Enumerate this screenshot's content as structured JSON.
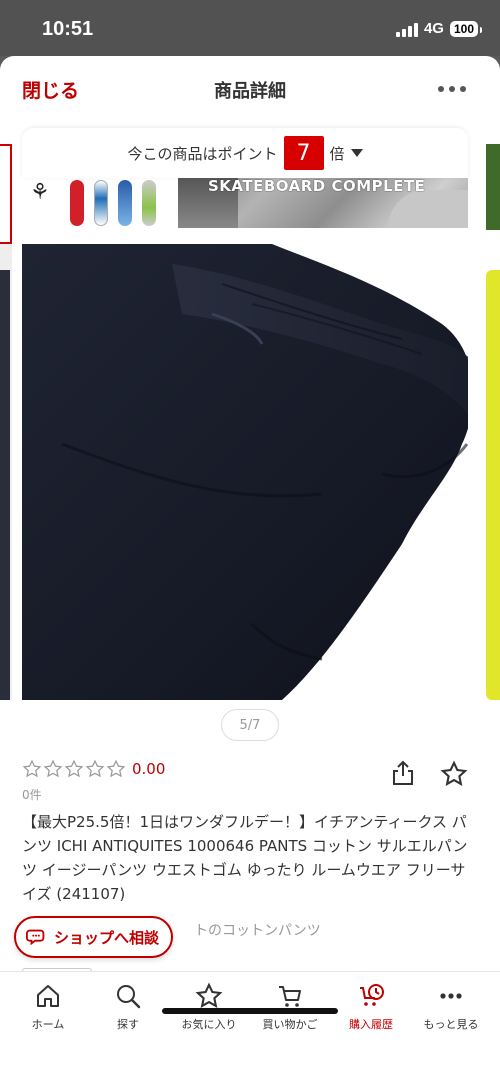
{
  "status_bar": {
    "time": "10:51",
    "network": "4G",
    "battery": "100"
  },
  "header": {
    "close_label": "閉じる",
    "title": "商品詳細",
    "more_icon": "more-dots-icon"
  },
  "point_banner": {
    "prefix": "今この商品はポイント",
    "multiplier": "7",
    "suffix": "倍"
  },
  "shop_banner": {
    "text": "SKATEBOARD COMPLETE"
  },
  "carousel": {
    "page_indicator": "5/7"
  },
  "rating": {
    "stars_filled": 0,
    "stars_total": 5,
    "value": "0.00",
    "review_count": "0件"
  },
  "product": {
    "title": "【最大P25.5倍！1日はワンダフルデー！】イチアンティークス パンツ ICHI ANTIQUITES 1000646 PANTS コットン サルエルパンツ イージーパンツ ウエストゴム ゆったり ルームウエア フリーサイズ (241107)",
    "subtitle_partial": "トのコットンパンツ"
  },
  "consult_button": {
    "label": "ショップへ相談"
  },
  "bottom_nav": {
    "items": [
      {
        "label": "ホーム",
        "icon": "home-icon"
      },
      {
        "label": "探す",
        "icon": "search-icon"
      },
      {
        "label": "お気に入り",
        "icon": "star-icon"
      },
      {
        "label": "買い物かご",
        "icon": "cart-icon"
      },
      {
        "label": "購入履歴",
        "icon": "history-icon"
      },
      {
        "label": "もっと見る",
        "icon": "more-icon"
      }
    ],
    "active_index": 4
  },
  "colors": {
    "accent": "#bf0000",
    "point_red": "#d60000"
  }
}
